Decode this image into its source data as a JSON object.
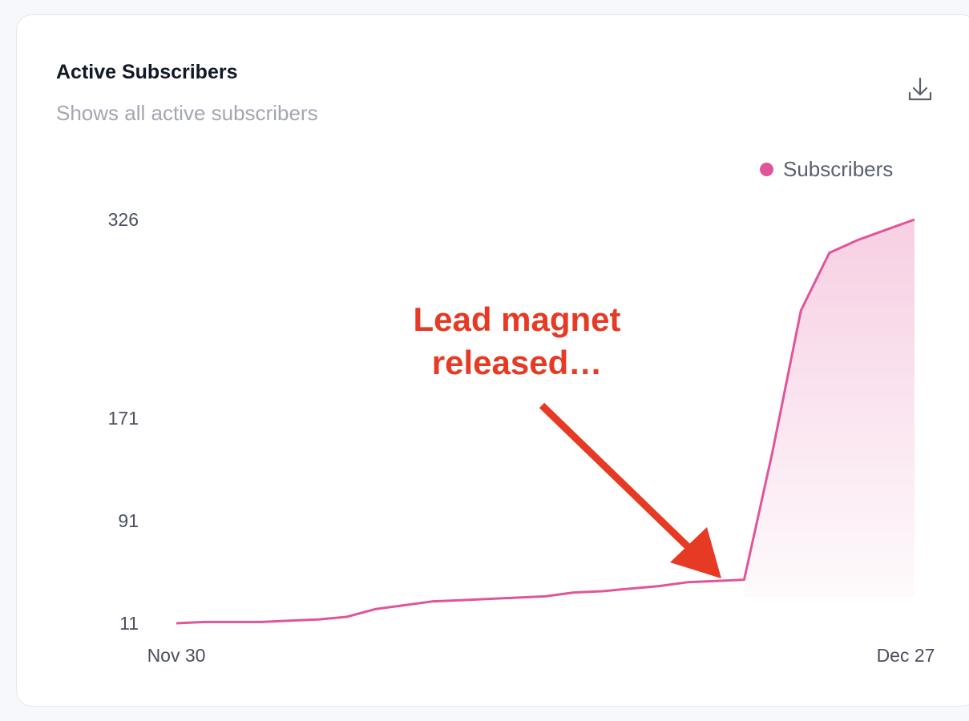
{
  "card": {
    "title": "Active Subscribers",
    "subtitle": "Shows all active subscribers",
    "download_icon": "download-icon"
  },
  "legend": {
    "label": "Subscribers",
    "color": "#e0559a"
  },
  "annotation": {
    "line1": "Lead magnet",
    "line2": "released…",
    "color": "#e63a24"
  },
  "chart_data": {
    "type": "area",
    "title": "Active Subscribers",
    "subtitle": "Shows all active subscribers",
    "xlabel": "",
    "ylabel": "",
    "x_ticks": [
      "Nov 30",
      "Dec 27"
    ],
    "y_ticks": [
      11,
      91,
      171,
      326
    ],
    "ylim": [
      11,
      326
    ],
    "grid": false,
    "legend_placement": "top-right",
    "annotations": [
      "Lead magnet released…"
    ],
    "series": [
      {
        "name": "Subscribers",
        "color": "#e0559a",
        "values": [
          11,
          12,
          12,
          12,
          13,
          14,
          16,
          22,
          25,
          28,
          29,
          30,
          31,
          32,
          35,
          36,
          38,
          40,
          43,
          44,
          45,
          145,
          255,
          300,
          310,
          318,
          326
        ]
      }
    ]
  }
}
